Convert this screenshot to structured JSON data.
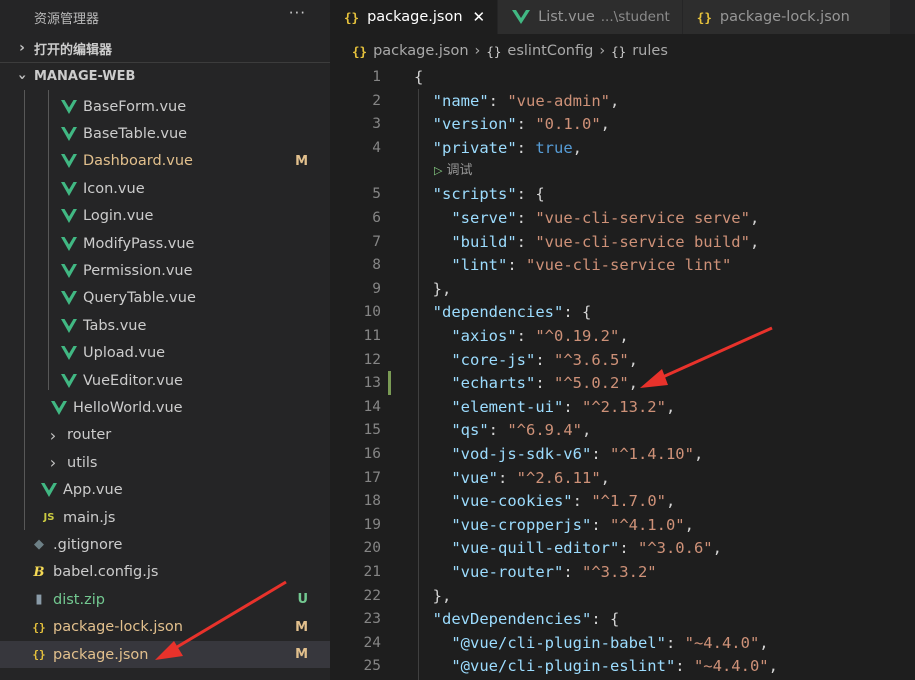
{
  "sidebar": {
    "title": "资源管理器",
    "more": "···",
    "open_editors": "打开的编辑器",
    "project": "MANAGE-WEB",
    "items": [
      {
        "label": "BaseForm.vue",
        "type": "vue",
        "indent": 60,
        "badge": ""
      },
      {
        "label": "BaseTable.vue",
        "type": "vue",
        "indent": 60,
        "badge": ""
      },
      {
        "label": "Dashboard.vue",
        "type": "vue",
        "indent": 60,
        "badge": "M"
      },
      {
        "label": "Icon.vue",
        "type": "vue",
        "indent": 60,
        "badge": ""
      },
      {
        "label": "Login.vue",
        "type": "vue",
        "indent": 60,
        "badge": ""
      },
      {
        "label": "ModifyPass.vue",
        "type": "vue",
        "indent": 60,
        "badge": ""
      },
      {
        "label": "Permission.vue",
        "type": "vue",
        "indent": 60,
        "badge": ""
      },
      {
        "label": "QueryTable.vue",
        "type": "vue",
        "indent": 60,
        "badge": ""
      },
      {
        "label": "Tabs.vue",
        "type": "vue",
        "indent": 60,
        "badge": ""
      },
      {
        "label": "Upload.vue",
        "type": "vue",
        "indent": 60,
        "badge": ""
      },
      {
        "label": "VueEditor.vue",
        "type": "vue",
        "indent": 60,
        "badge": ""
      },
      {
        "label": "HelloWorld.vue",
        "type": "vue",
        "indent": 50,
        "badge": ""
      },
      {
        "label": "router",
        "type": "folder",
        "indent": 44,
        "badge": ""
      },
      {
        "label": "utils",
        "type": "folder",
        "indent": 44,
        "badge": ""
      },
      {
        "label": "App.vue",
        "type": "vue",
        "indent": 40,
        "badge": ""
      },
      {
        "label": "main.js",
        "type": "js",
        "indent": 40,
        "badge": ""
      },
      {
        "label": ".gitignore",
        "type": "git",
        "indent": 30,
        "badge": ""
      },
      {
        "label": "babel.config.js",
        "type": "babel",
        "indent": 30,
        "badge": ""
      },
      {
        "label": "dist.zip",
        "type": "zip",
        "indent": 30,
        "badge": "U"
      },
      {
        "label": "package-lock.json",
        "type": "json",
        "indent": 30,
        "badge": "M"
      },
      {
        "label": "package.json",
        "type": "json",
        "indent": 30,
        "badge": "M",
        "selected": true
      }
    ]
  },
  "tabs": [
    {
      "label": "package.json",
      "icon": "{}",
      "active": true,
      "close": "✕"
    },
    {
      "label": "List.vue",
      "icon": "vue",
      "desc": "...\\student"
    },
    {
      "label": "package-lock.json",
      "icon": "{}"
    }
  ],
  "breadcrumb": [
    {
      "icon": "{}",
      "label": "package.json"
    },
    {
      "icon": "{}",
      "label": "eslintConfig"
    },
    {
      "icon": "{}",
      "label": "rules"
    }
  ],
  "codelens": {
    "label": "调试"
  },
  "code_lines": [
    {
      "n": "1",
      "parts": [
        [
          "p",
          "{"
        ]
      ]
    },
    {
      "n": "2",
      "parts": [
        [
          "p",
          "  "
        ],
        [
          "k",
          "\"name\""
        ],
        [
          "p",
          ": "
        ],
        [
          "s",
          "\"vue-admin\""
        ],
        [
          "p",
          ","
        ]
      ]
    },
    {
      "n": "3",
      "parts": [
        [
          "p",
          "  "
        ],
        [
          "k",
          "\"version\""
        ],
        [
          "p",
          ": "
        ],
        [
          "s",
          "\"0.1.0\""
        ],
        [
          "p",
          ","
        ]
      ]
    },
    {
      "n": "4",
      "parts": [
        [
          "p",
          "  "
        ],
        [
          "k",
          "\"private\""
        ],
        [
          "p",
          ": "
        ],
        [
          "b",
          "true"
        ],
        [
          "p",
          ","
        ]
      ]
    },
    {
      "n": "5",
      "parts": [
        [
          "p",
          "  "
        ],
        [
          "k",
          "\"scripts\""
        ],
        [
          "p",
          ": {"
        ]
      ]
    },
    {
      "n": "6",
      "parts": [
        [
          "p",
          "    "
        ],
        [
          "k",
          "\"serve\""
        ],
        [
          "p",
          ": "
        ],
        [
          "s",
          "\"vue-cli-service serve\""
        ],
        [
          "p",
          ","
        ]
      ]
    },
    {
      "n": "7",
      "parts": [
        [
          "p",
          "    "
        ],
        [
          "k",
          "\"build\""
        ],
        [
          "p",
          ": "
        ],
        [
          "s",
          "\"vue-cli-service build\""
        ],
        [
          "p",
          ","
        ]
      ]
    },
    {
      "n": "8",
      "parts": [
        [
          "p",
          "    "
        ],
        [
          "k",
          "\"lint\""
        ],
        [
          "p",
          ": "
        ],
        [
          "s",
          "\"vue-cli-service lint\""
        ]
      ]
    },
    {
      "n": "9",
      "parts": [
        [
          "p",
          "  },"
        ]
      ]
    },
    {
      "n": "10",
      "parts": [
        [
          "p",
          "  "
        ],
        [
          "k",
          "\"dependencies\""
        ],
        [
          "p",
          ": {"
        ]
      ]
    },
    {
      "n": "11",
      "parts": [
        [
          "p",
          "    "
        ],
        [
          "k",
          "\"axios\""
        ],
        [
          "p",
          ": "
        ],
        [
          "s",
          "\"^0.19.2\""
        ],
        [
          "p",
          ","
        ]
      ]
    },
    {
      "n": "12",
      "parts": [
        [
          "p",
          "    "
        ],
        [
          "k",
          "\"core-js\""
        ],
        [
          "p",
          ": "
        ],
        [
          "s",
          "\"^3.6.5\""
        ],
        [
          "p",
          ","
        ]
      ]
    },
    {
      "n": "13",
      "parts": [
        [
          "p",
          "    "
        ],
        [
          "k",
          "\"echarts\""
        ],
        [
          "p",
          ": "
        ],
        [
          "s",
          "\"^5.0.2\""
        ],
        [
          "p",
          ","
        ]
      ],
      "modified": true
    },
    {
      "n": "14",
      "parts": [
        [
          "p",
          "    "
        ],
        [
          "k",
          "\"element-ui\""
        ],
        [
          "p",
          ": "
        ],
        [
          "s",
          "\"^2.13.2\""
        ],
        [
          "p",
          ","
        ]
      ]
    },
    {
      "n": "15",
      "parts": [
        [
          "p",
          "    "
        ],
        [
          "k",
          "\"qs\""
        ],
        [
          "p",
          ": "
        ],
        [
          "s",
          "\"^6.9.4\""
        ],
        [
          "p",
          ","
        ]
      ]
    },
    {
      "n": "16",
      "parts": [
        [
          "p",
          "    "
        ],
        [
          "k",
          "\"vod-js-sdk-v6\""
        ],
        [
          "p",
          ": "
        ],
        [
          "s",
          "\"^1.4.10\""
        ],
        [
          "p",
          ","
        ]
      ]
    },
    {
      "n": "17",
      "parts": [
        [
          "p",
          "    "
        ],
        [
          "k",
          "\"vue\""
        ],
        [
          "p",
          ": "
        ],
        [
          "s",
          "\"^2.6.11\""
        ],
        [
          "p",
          ","
        ]
      ]
    },
    {
      "n": "18",
      "parts": [
        [
          "p",
          "    "
        ],
        [
          "k",
          "\"vue-cookies\""
        ],
        [
          "p",
          ": "
        ],
        [
          "s",
          "\"^1.7.0\""
        ],
        [
          "p",
          ","
        ]
      ]
    },
    {
      "n": "19",
      "parts": [
        [
          "p",
          "    "
        ],
        [
          "k",
          "\"vue-cropperjs\""
        ],
        [
          "p",
          ": "
        ],
        [
          "s",
          "\"^4.1.0\""
        ],
        [
          "p",
          ","
        ]
      ]
    },
    {
      "n": "20",
      "parts": [
        [
          "p",
          "    "
        ],
        [
          "k",
          "\"vue-quill-editor\""
        ],
        [
          "p",
          ": "
        ],
        [
          "s",
          "\"^3.0.6\""
        ],
        [
          "p",
          ","
        ]
      ]
    },
    {
      "n": "21",
      "parts": [
        [
          "p",
          "    "
        ],
        [
          "k",
          "\"vue-router\""
        ],
        [
          "p",
          ": "
        ],
        [
          "s",
          "\"^3.3.2\""
        ]
      ]
    },
    {
      "n": "22",
      "parts": [
        [
          "p",
          "  },"
        ]
      ]
    },
    {
      "n": "23",
      "parts": [
        [
          "p",
          "  "
        ],
        [
          "k",
          "\"devDependencies\""
        ],
        [
          "p",
          ": {"
        ]
      ]
    },
    {
      "n": "24",
      "parts": [
        [
          "p",
          "    "
        ],
        [
          "k",
          "\"@vue/cli-plugin-babel\""
        ],
        [
          "p",
          ": "
        ],
        [
          "s",
          "\"~4.4.0\""
        ],
        [
          "p",
          ","
        ]
      ]
    },
    {
      "n": "25",
      "parts": [
        [
          "p",
          "    "
        ],
        [
          "k",
          "\"@vue/cli-plugin-eslint\""
        ],
        [
          "p",
          ": "
        ],
        [
          "s",
          "\"~4.4.0\""
        ],
        [
          "p",
          ","
        ]
      ]
    }
  ],
  "colors": {
    "modified": "#e2c08d",
    "untracked": "#73c991",
    "vue_green": "#41b883",
    "json_yellow": "#e6c23c",
    "annotation_arrow": "#e8322b"
  }
}
